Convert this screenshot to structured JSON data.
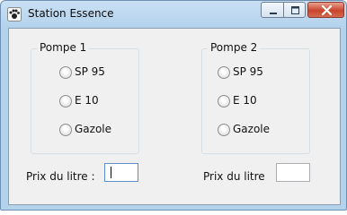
{
  "window": {
    "title": "Station Essence",
    "icon": "app-icon",
    "controls": {
      "minimize": "minimize-icon",
      "maximize": "maximize-icon",
      "close": "close-icon"
    }
  },
  "pompe1": {
    "title": "Pompe 1",
    "options": [
      "SP 95",
      "E 10",
      "Gazole"
    ],
    "price_label": "Prix du litre :",
    "price_value": ""
  },
  "pompe2": {
    "title": "Pompe 2",
    "options": [
      "SP 95",
      "E 10",
      "Gazole"
    ],
    "price_label": "Prix du litre",
    "price_value": ""
  }
}
